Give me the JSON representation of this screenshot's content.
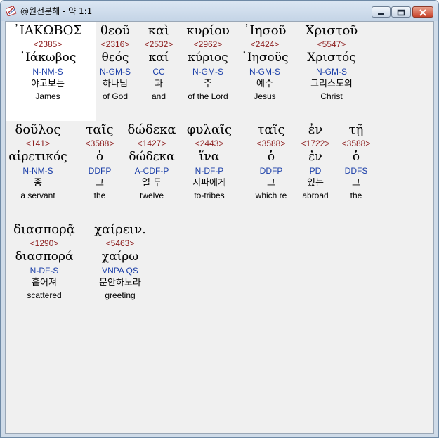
{
  "window": {
    "title": "@원전분해 - 약 1:1"
  },
  "rows": [
    [
      {
        "greek": "᾿ΙΑΚΩΒΟΣ",
        "strong": "<2385>",
        "lemma": "᾿Ιάκωβος",
        "morph": "N-NM-S",
        "korean": "야고보는",
        "english": "James"
      },
      {
        "greek": "θεοῦ",
        "strong": "<2316>",
        "lemma": "θεός",
        "morph": "N-GM-S",
        "korean": "하나님",
        "english": "of God"
      },
      {
        "greek": "καὶ",
        "strong": "<2532>",
        "lemma": "καί",
        "morph": "CC",
        "korean": "과",
        "english": "and"
      },
      {
        "greek": "κυρίου",
        "strong": "<2962>",
        "lemma": "κύριος",
        "morph": "N-GM-S",
        "korean": "주",
        "english": "of the Lord"
      },
      {
        "greek": "᾿Ιησοῦ",
        "strong": "<2424>",
        "lemma": "᾿Ιησοῦς",
        "morph": "N-GM-S",
        "korean": "예수",
        "english": "Jesus"
      },
      {
        "greek": "Χριστοῦ",
        "strong": "<5547>",
        "lemma": "Χριστός",
        "morph": "N-GM-S",
        "korean": "그리스도의",
        "english": "Christ"
      }
    ],
    [
      {
        "greek": "δοῦλος",
        "strong": "<141>",
        "lemma": "αἱρετικός",
        "morph": "N-NM-S",
        "korean": "종",
        "english": "a servant"
      },
      {
        "greek": "ταῖς",
        "strong": "<3588>",
        "lemma": "ὁ",
        "morph": "DDFP",
        "korean": "그",
        "english": "the"
      },
      {
        "greek": "δώδεκα",
        "strong": "<1427>",
        "lemma": "δώδεκα",
        "morph": "A-CDF-P",
        "korean": "열 두",
        "english": "twelve"
      },
      {
        "greek": "φυλαῖς",
        "strong": "<2443>",
        "lemma": "ἵνα",
        "morph": "N-DF-P",
        "korean": "지파에게",
        "english": "to-tribes"
      },
      {
        "greek": "ταῖς",
        "strong": "<3588>",
        "lemma": "ὁ",
        "morph": "DDFP",
        "korean": "그",
        "english": "which re"
      },
      {
        "greek": "ἐν",
        "strong": "<1722>",
        "lemma": "ἐν",
        "morph": "PD",
        "korean": "있는",
        "english": "abroad"
      },
      {
        "greek": "τῇ",
        "strong": "<3588>",
        "lemma": "ὁ",
        "morph": "DDFS",
        "korean": "그",
        "english": "the"
      }
    ],
    [
      {
        "greek": "διασπορᾷ",
        "strong": "<1290>",
        "lemma": "διασπορά",
        "morph": "N-DF-S",
        "korean": "흩어져",
        "english": "scattered"
      },
      {
        "greek": "χαίρειν.",
        "strong": "<5463>",
        "lemma": "χαίρω",
        "morph": "VNPA QS",
        "korean": "문안하노라",
        "english": "greeting"
      }
    ]
  ]
}
